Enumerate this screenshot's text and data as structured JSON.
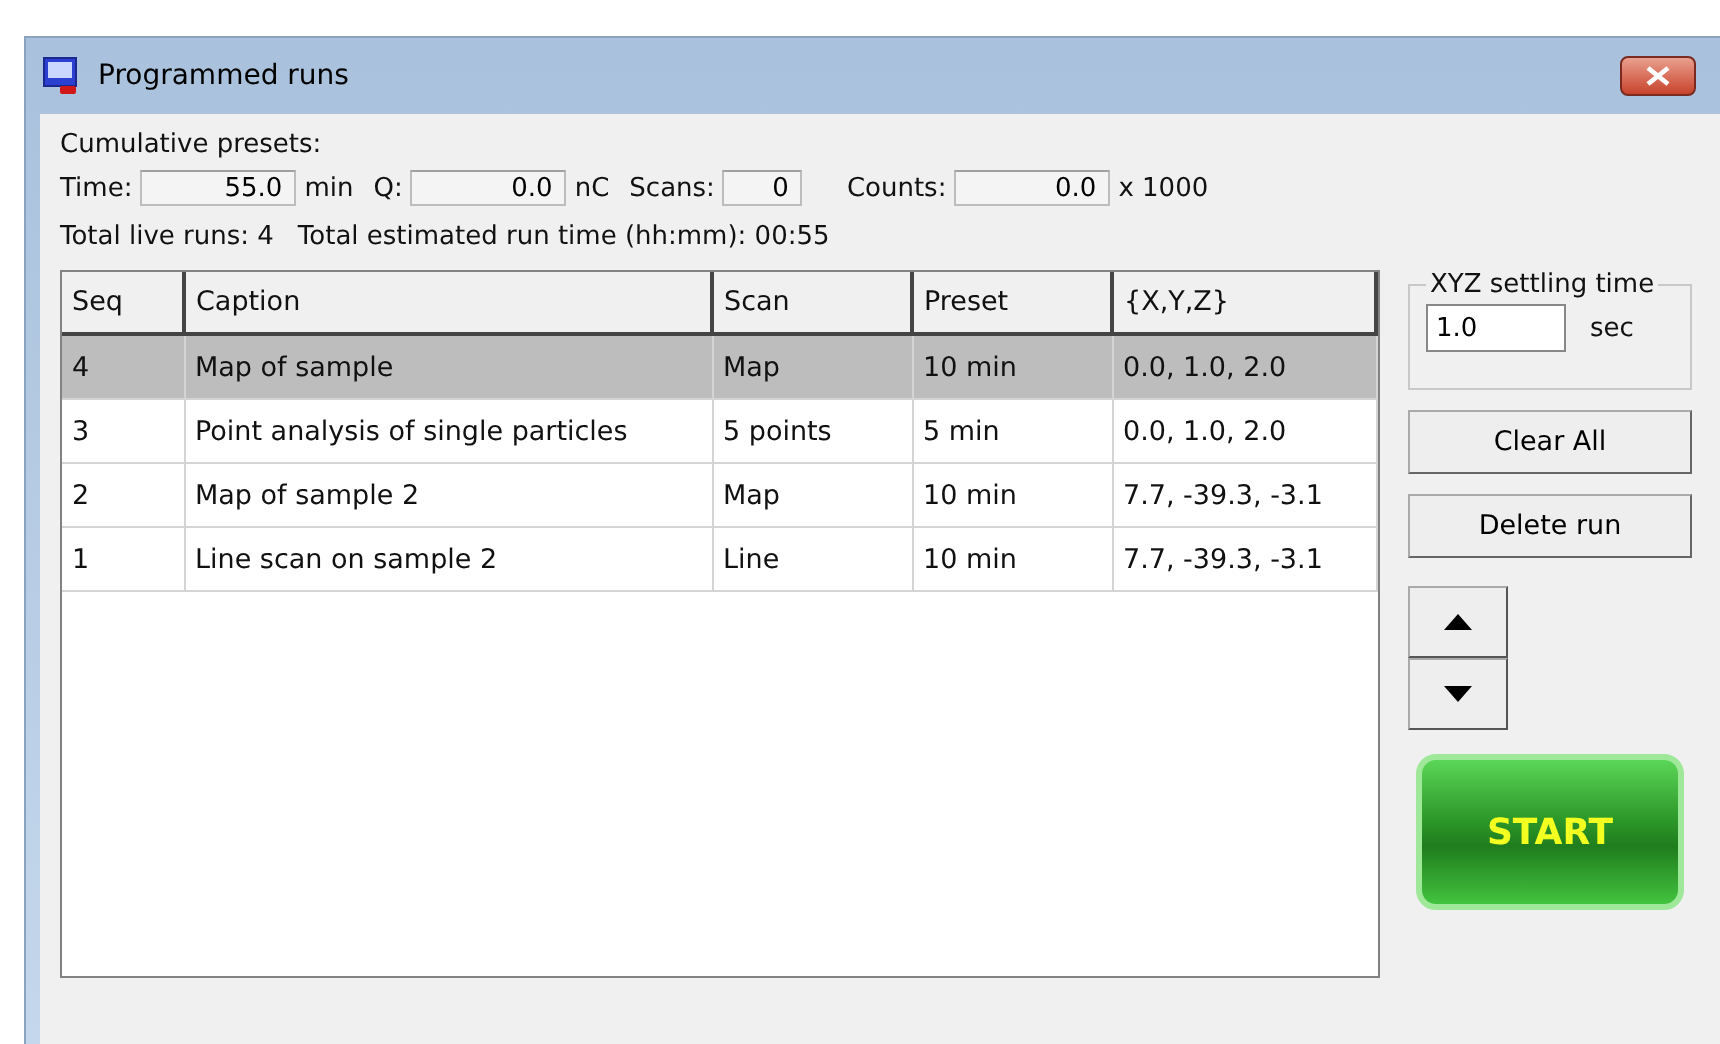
{
  "window": {
    "title": "Programmed runs"
  },
  "presets": {
    "heading": "Cumulative presets:",
    "fields": [
      {
        "label": "Time:",
        "value": "55.0",
        "unit": "min"
      },
      {
        "label": "Q:",
        "value": "0.0",
        "unit": "nC"
      },
      {
        "label": "Scans:",
        "value": "0"
      },
      {
        "label": "Counts:",
        "value": "0.0",
        "unit": "x 1000"
      }
    ]
  },
  "summary": {
    "live_runs": "Total live runs: 4",
    "run_time": "Total estimated run time (hh:mm): 00:55"
  },
  "table": {
    "columns": [
      "Seq",
      "Caption",
      "Scan",
      "Preset",
      "{X,Y,Z}"
    ],
    "rows": [
      {
        "cells": [
          "4",
          "Map of sample",
          "Map",
          "10 min",
          "0.0, 1.0, 2.0"
        ],
        "selected": true
      },
      {
        "cells": [
          "3",
          "Point analysis of single particles",
          "5 points",
          "5 min",
          "0.0, 1.0, 2.0"
        ],
        "selected": false
      },
      {
        "cells": [
          "2",
          "Map of sample 2",
          "Map",
          "10 min",
          "7.7, -39.3, -3.1"
        ],
        "selected": false
      },
      {
        "cells": [
          "1",
          "Line scan on sample 2",
          "Line",
          "10 min",
          "7.7, -39.3, -3.1"
        ],
        "selected": false
      }
    ]
  },
  "settling": {
    "legend": "XYZ settling time",
    "value": "1.0",
    "unit": "sec"
  },
  "buttons": {
    "clear": "Clear All",
    "delete": "Delete run",
    "start": "START"
  }
}
